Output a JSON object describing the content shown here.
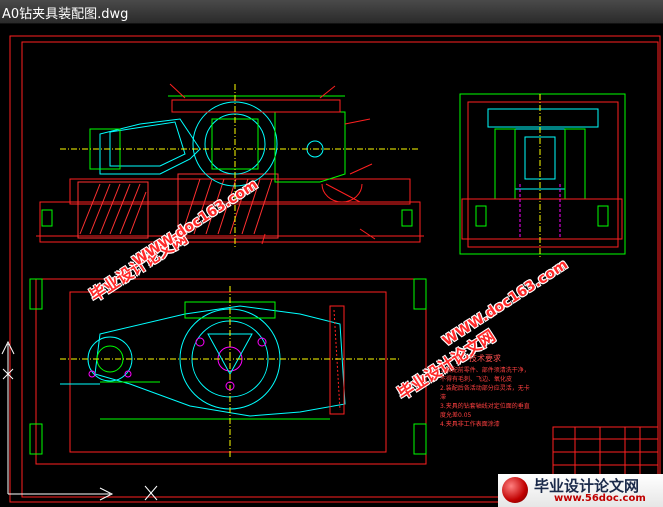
{
  "window": {
    "title": "A0钻夹具装配图.dwg"
  },
  "watermarks": {
    "site_name": "毕业设计论文网",
    "site_url": "WWW.doc163.com"
  },
  "technical_requirements": {
    "heading": "技术要求",
    "lines": [
      "1.装配前零件、部件须清洗干净，不得有毛刺、飞边、氧化皮",
      "2.装配后各活动部分应灵活，无卡滞",
      "3.夹具的钻套轴线对定位面的垂直度允差0.05",
      "4.夹具非工作表面涂漆"
    ]
  },
  "corner_logo": {
    "name": "毕业设计论文网",
    "url": "www.56doc.com"
  },
  "colors": {
    "frame": "#ff2020",
    "outline": "#00ff00",
    "detail": "#00ffff",
    "center_line": "#ffff00",
    "hidden": "#ff00ff"
  }
}
